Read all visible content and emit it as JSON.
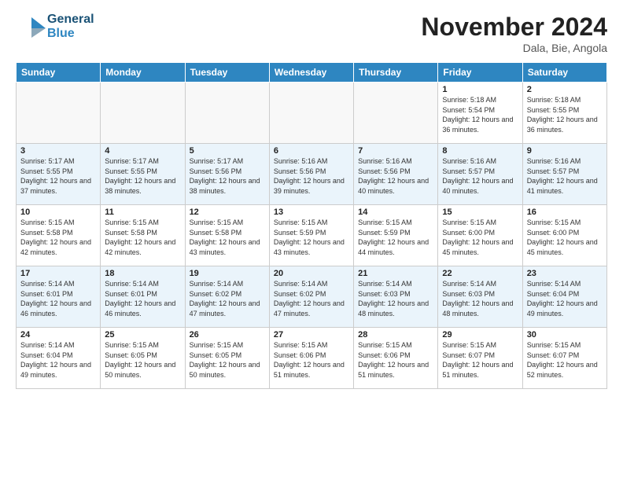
{
  "header": {
    "logo_line1": "General",
    "logo_line2": "Blue",
    "month": "November 2024",
    "location": "Dala, Bie, Angola"
  },
  "weekdays": [
    "Sunday",
    "Monday",
    "Tuesday",
    "Wednesday",
    "Thursday",
    "Friday",
    "Saturday"
  ],
  "weeks": [
    [
      {
        "day": "",
        "info": ""
      },
      {
        "day": "",
        "info": ""
      },
      {
        "day": "",
        "info": ""
      },
      {
        "day": "",
        "info": ""
      },
      {
        "day": "",
        "info": ""
      },
      {
        "day": "1",
        "info": "Sunrise: 5:18 AM\nSunset: 5:54 PM\nDaylight: 12 hours and 36 minutes."
      },
      {
        "day": "2",
        "info": "Sunrise: 5:18 AM\nSunset: 5:55 PM\nDaylight: 12 hours and 36 minutes."
      }
    ],
    [
      {
        "day": "3",
        "info": "Sunrise: 5:17 AM\nSunset: 5:55 PM\nDaylight: 12 hours and 37 minutes."
      },
      {
        "day": "4",
        "info": "Sunrise: 5:17 AM\nSunset: 5:55 PM\nDaylight: 12 hours and 38 minutes."
      },
      {
        "day": "5",
        "info": "Sunrise: 5:17 AM\nSunset: 5:56 PM\nDaylight: 12 hours and 38 minutes."
      },
      {
        "day": "6",
        "info": "Sunrise: 5:16 AM\nSunset: 5:56 PM\nDaylight: 12 hours and 39 minutes."
      },
      {
        "day": "7",
        "info": "Sunrise: 5:16 AM\nSunset: 5:56 PM\nDaylight: 12 hours and 40 minutes."
      },
      {
        "day": "8",
        "info": "Sunrise: 5:16 AM\nSunset: 5:57 PM\nDaylight: 12 hours and 40 minutes."
      },
      {
        "day": "9",
        "info": "Sunrise: 5:16 AM\nSunset: 5:57 PM\nDaylight: 12 hours and 41 minutes."
      }
    ],
    [
      {
        "day": "10",
        "info": "Sunrise: 5:15 AM\nSunset: 5:58 PM\nDaylight: 12 hours and 42 minutes."
      },
      {
        "day": "11",
        "info": "Sunrise: 5:15 AM\nSunset: 5:58 PM\nDaylight: 12 hours and 42 minutes."
      },
      {
        "day": "12",
        "info": "Sunrise: 5:15 AM\nSunset: 5:58 PM\nDaylight: 12 hours and 43 minutes."
      },
      {
        "day": "13",
        "info": "Sunrise: 5:15 AM\nSunset: 5:59 PM\nDaylight: 12 hours and 43 minutes."
      },
      {
        "day": "14",
        "info": "Sunrise: 5:15 AM\nSunset: 5:59 PM\nDaylight: 12 hours and 44 minutes."
      },
      {
        "day": "15",
        "info": "Sunrise: 5:15 AM\nSunset: 6:00 PM\nDaylight: 12 hours and 45 minutes."
      },
      {
        "day": "16",
        "info": "Sunrise: 5:15 AM\nSunset: 6:00 PM\nDaylight: 12 hours and 45 minutes."
      }
    ],
    [
      {
        "day": "17",
        "info": "Sunrise: 5:14 AM\nSunset: 6:01 PM\nDaylight: 12 hours and 46 minutes."
      },
      {
        "day": "18",
        "info": "Sunrise: 5:14 AM\nSunset: 6:01 PM\nDaylight: 12 hours and 46 minutes."
      },
      {
        "day": "19",
        "info": "Sunrise: 5:14 AM\nSunset: 6:02 PM\nDaylight: 12 hours and 47 minutes."
      },
      {
        "day": "20",
        "info": "Sunrise: 5:14 AM\nSunset: 6:02 PM\nDaylight: 12 hours and 47 minutes."
      },
      {
        "day": "21",
        "info": "Sunrise: 5:14 AM\nSunset: 6:03 PM\nDaylight: 12 hours and 48 minutes."
      },
      {
        "day": "22",
        "info": "Sunrise: 5:14 AM\nSunset: 6:03 PM\nDaylight: 12 hours and 48 minutes."
      },
      {
        "day": "23",
        "info": "Sunrise: 5:14 AM\nSunset: 6:04 PM\nDaylight: 12 hours and 49 minutes."
      }
    ],
    [
      {
        "day": "24",
        "info": "Sunrise: 5:14 AM\nSunset: 6:04 PM\nDaylight: 12 hours and 49 minutes."
      },
      {
        "day": "25",
        "info": "Sunrise: 5:15 AM\nSunset: 6:05 PM\nDaylight: 12 hours and 50 minutes."
      },
      {
        "day": "26",
        "info": "Sunrise: 5:15 AM\nSunset: 6:05 PM\nDaylight: 12 hours and 50 minutes."
      },
      {
        "day": "27",
        "info": "Sunrise: 5:15 AM\nSunset: 6:06 PM\nDaylight: 12 hours and 51 minutes."
      },
      {
        "day": "28",
        "info": "Sunrise: 5:15 AM\nSunset: 6:06 PM\nDaylight: 12 hours and 51 minutes."
      },
      {
        "day": "29",
        "info": "Sunrise: 5:15 AM\nSunset: 6:07 PM\nDaylight: 12 hours and 51 minutes."
      },
      {
        "day": "30",
        "info": "Sunrise: 5:15 AM\nSunset: 6:07 PM\nDaylight: 12 hours and 52 minutes."
      }
    ]
  ]
}
